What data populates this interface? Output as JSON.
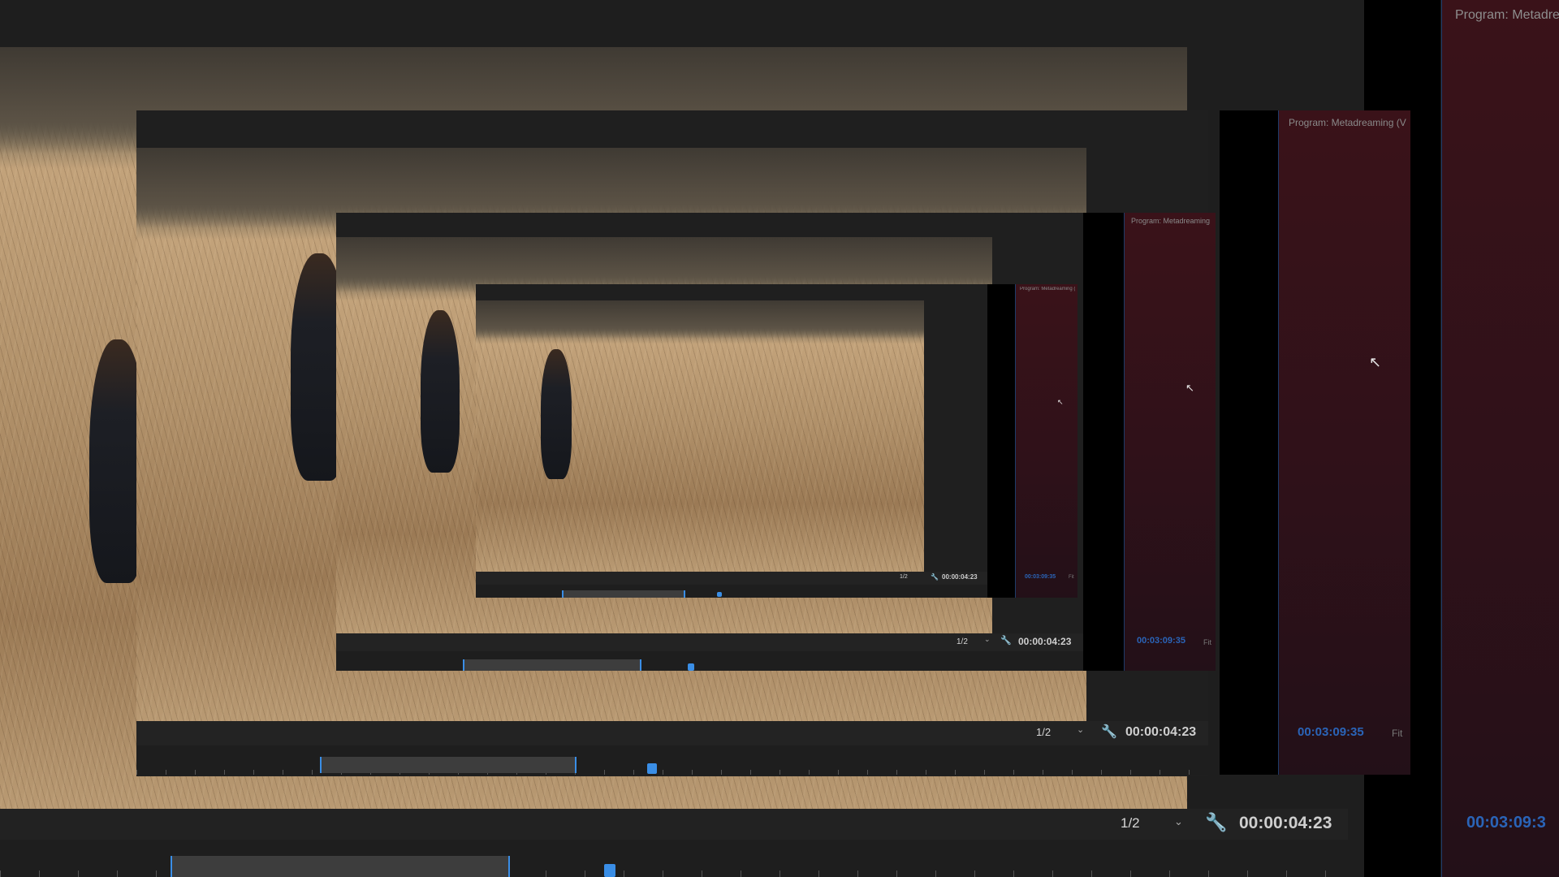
{
  "monitor": {
    "resolution_options": [
      "1/2"
    ],
    "resolution": "1/2",
    "timecode": "00:00:04:23"
  },
  "program_monitor": {
    "title": "Program: Metadreaming (V",
    "title_large": "Program: Metadre",
    "timecode": "00:03:09:35",
    "timecode_large": "00:03:09:3",
    "fit": "Fit"
  },
  "icons": {
    "settings": "wrench-icon",
    "dropdown": "chevron-down-icon",
    "cursor": "mouse-pointer-icon"
  },
  "colors": {
    "accent": "#3a8ee6",
    "program_bg": "#3a1219",
    "panel": "#232323"
  }
}
